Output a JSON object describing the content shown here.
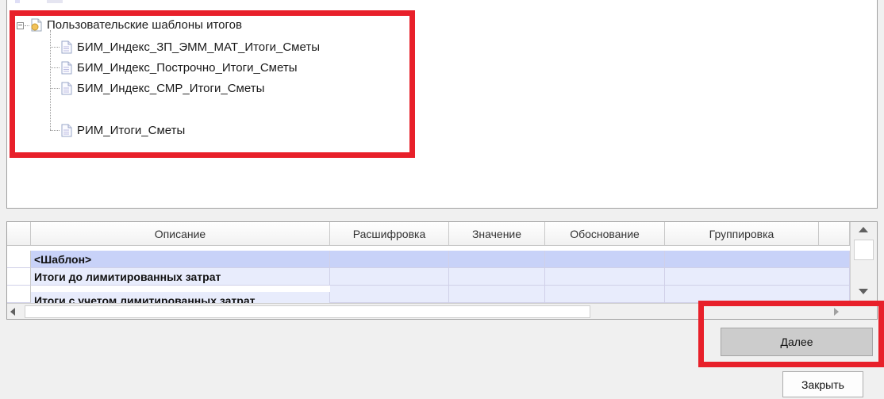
{
  "tree": {
    "group_label": "Пользовательские шаблоны итогов",
    "items": [
      {
        "label": "БИМ_Индекс_ЗП_ЭММ_МАТ_Итоги_Сметы"
      },
      {
        "label": "БИМ_Индекс_Построчно_Итоги_Сметы"
      },
      {
        "label": "БИМ_Индекс_СМР_Итоги_Сметы"
      },
      {
        "label": "РИМ_Итоги_Сметы"
      }
    ]
  },
  "grid": {
    "columns": [
      "Описание",
      "Расшифровка",
      "Значение",
      "Обоснование",
      "Группировка"
    ],
    "rows": [
      {
        "description": "<Шаблон>",
        "selected": true
      },
      {
        "description": "Итоги до лимитированных затрат",
        "selected": false
      },
      {
        "description": "Итоги с учетом лимитированных затрат",
        "selected": false
      }
    ]
  },
  "buttons": {
    "next": "Далее",
    "close": "Закрыть"
  },
  "colors": {
    "highlight": "#e8202a",
    "selected_row": "#c8d2f8",
    "row_bg": "#e8ecfc"
  }
}
